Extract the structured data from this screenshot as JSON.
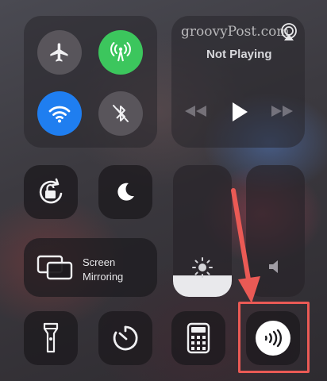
{
  "watermark": "groovyPost.com",
  "connectivity": {
    "airplane": "airplane-mode",
    "cellular": "cellular-data",
    "wifi": "wifi",
    "bluetooth": "bluetooth-off"
  },
  "media": {
    "status": "Not Playing",
    "airplay_icon": "airplay-icon"
  },
  "screen_mirroring": {
    "line1": "Screen",
    "line2": "Mirroring"
  },
  "brightness": {
    "level_percent": 16
  },
  "volume": {
    "level_percent": 0
  },
  "bottom_row": [
    "flashlight-icon",
    "timer-icon",
    "calculator-icon",
    "nfc-icon"
  ],
  "colors": {
    "accent_green": "#3cc65d",
    "accent_blue": "#1f7ef0",
    "highlight_red": "#ea5a55"
  }
}
